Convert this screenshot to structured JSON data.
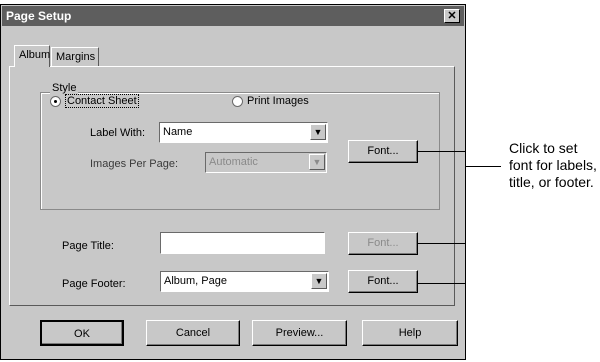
{
  "window": {
    "title": "Page Setup",
    "close_icon": "close-icon"
  },
  "tabs": [
    {
      "label": "Album",
      "selected": true
    },
    {
      "label": "Margins",
      "selected": false
    }
  ],
  "style_group": {
    "label": "Style",
    "option_contact_sheet": "Contact Sheet",
    "option_print_images": "Print Images",
    "selected": "Contact Sheet"
  },
  "label_with": {
    "label": "Label With:",
    "value": "Name"
  },
  "images_per_page": {
    "label": "Images Per Page:",
    "value": "Automatic",
    "disabled": true
  },
  "page_title": {
    "label": "Page Title:",
    "value": ""
  },
  "page_footer": {
    "label": "Page Footer:",
    "value": "Album, Page"
  },
  "font_buttons": {
    "label_font": "Font...",
    "title_font": "Font...",
    "footer_font": "Font..."
  },
  "footer_buttons": {
    "ok": "OK",
    "cancel": "Cancel",
    "preview": "Preview...",
    "help": "Help"
  },
  "callout": {
    "text": "Click to set font for labels, title, or footer."
  },
  "colors": {
    "dialog_bg": "#c8c8c8",
    "titlebar_bg": "#5e5e5e"
  }
}
